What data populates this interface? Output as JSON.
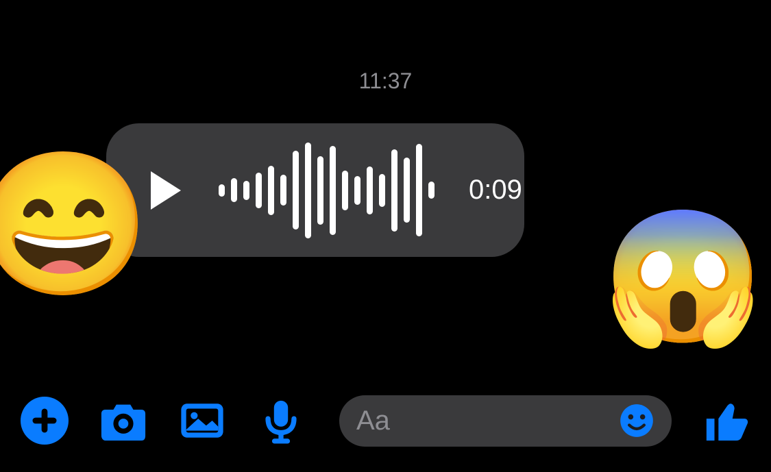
{
  "timestamp": "11:37",
  "message": {
    "type": "voice",
    "duration": "0:09",
    "waveform_heights": [
      18,
      35,
      28,
      52,
      72,
      45,
      115,
      140,
      100,
      130,
      58,
      42,
      70,
      48,
      120,
      95,
      135,
      25
    ]
  },
  "stickers": {
    "left": "😄",
    "right": "😱"
  },
  "composer": {
    "placeholder": "Aa"
  },
  "colors": {
    "accent": "#0a7cff",
    "bubble": "#3a3a3c",
    "muted": "#8e8e93"
  }
}
